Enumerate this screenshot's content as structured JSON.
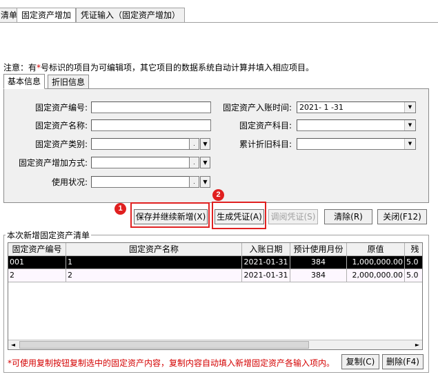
{
  "top_tabs": [
    {
      "label": "清单"
    },
    {
      "label": "固定资产增加"
    },
    {
      "label": "凭证输入（固定资产增加）"
    }
  ],
  "note": {
    "prefix": "注意：有",
    "star": "*",
    "suffix": "号标识的项目为可编辑项，其它项目的数据系统自动计算并填入相应项目。"
  },
  "panel_tabs": [
    {
      "label": "基本信息"
    },
    {
      "label": "折旧信息"
    }
  ],
  "form": {
    "asset_code_label": "固定资产编号:",
    "asset_code_value": "",
    "asset_name_label": "固定资产名称:",
    "asset_name_value": "",
    "asset_category_label": "固定资产类别:",
    "asset_category_value": "",
    "increase_method_label": "固定资产增加方式:",
    "increase_method_value": "",
    "usage_status_label": "使用状况:",
    "usage_status_value": "",
    "entry_date_label": "固定资产入账时间:",
    "entry_date_value": "2021- 1 -31",
    "asset_account_label": "固定资产科目:",
    "asset_account_value": "",
    "depreciation_account_label": "累计折旧科目:",
    "depreciation_account_value": "",
    "ellipsis": ".",
    "arrow": "▼"
  },
  "buttons": {
    "save_continue": "保存并继续新增(X)",
    "generate_voucher": "生成凭证(A)",
    "view_voucher": "调阅凭证(S)",
    "clear": "清除(R)",
    "close": "关闭(F12)",
    "copy": "复制(C)",
    "delete": "删除(F4)"
  },
  "badges": {
    "one": "1",
    "two": "2"
  },
  "list": {
    "title": "本次新增固定资产清单",
    "columns": [
      "固定资产编号",
      "固定资产名称",
      "入账日期",
      "预计使用月份",
      "原值",
      "残"
    ],
    "rows": [
      [
        "001",
        "1",
        "2021-01-31",
        "384",
        "1,000,000.00",
        "5.0"
      ],
      [
        "2",
        "2",
        "2021-01-31",
        "384",
        "2,000,000.00",
        "5.0"
      ]
    ],
    "scroll_left": "◄",
    "scroll_right": "►"
  },
  "hint": "*可使用复制按钮复制选中的固定资产内容，复制内容自动填入新增固定资产各输入项内。",
  "colors": {
    "highlight": "#e02020",
    "hint_text": "#d40000"
  }
}
